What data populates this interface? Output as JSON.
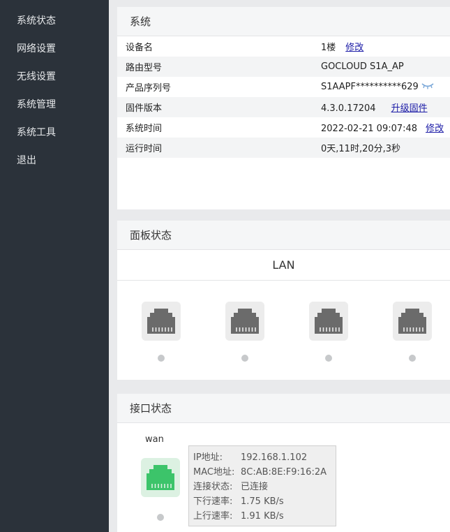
{
  "sidebar": {
    "items": [
      {
        "label": "系统状态"
      },
      {
        "label": "网络设置"
      },
      {
        "label": "无线设置"
      },
      {
        "label": "系统管理"
      },
      {
        "label": "系统工具"
      },
      {
        "label": "退出"
      }
    ]
  },
  "system": {
    "title": "系统",
    "rows": [
      {
        "key": "设备名",
        "value": "1楼",
        "link": "修改"
      },
      {
        "key": "路由型号",
        "value": "GOCLOUD S1A_AP"
      },
      {
        "key": "产品序列号",
        "value": "S1AAPF**********629"
      },
      {
        "key": "固件版本",
        "value": "4.3.0.17204",
        "link": "升级固件"
      },
      {
        "key": "系统时间",
        "value": "2022-02-21 09:07:48",
        "link": "修改"
      },
      {
        "key": "运行时间",
        "value": "0天,11时,20分,3秒"
      }
    ]
  },
  "panel": {
    "title": "面板状态",
    "lan_label": "LAN"
  },
  "interfaces": {
    "title": "接口状态",
    "wan": {
      "label": "wan",
      "ip_label": "IP地址:",
      "ip": "192.168.1.102",
      "mac_label": "MAC地址:",
      "mac": "8C:AB:8E:F9:16:2A",
      "conn_label": "连接状态:",
      "conn": "已连接",
      "down_label": "下行速率:",
      "down": "1.75 KB/s",
      "up_label": "上行速率:",
      "up": "1.91 KB/s"
    }
  },
  "colors": {
    "sidebar_bg": "#2b323a",
    "link": "#1a1aa6",
    "port_inactive": "#6b6b6b",
    "port_active": "#3cc46a"
  }
}
